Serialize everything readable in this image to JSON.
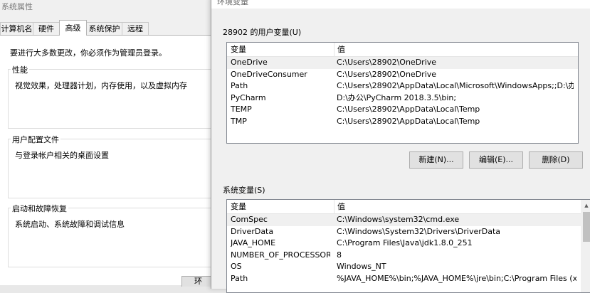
{
  "system_properties": {
    "title": "系统属性",
    "tabs": [
      "计算机名",
      "硬件",
      "高级",
      "系统保护",
      "远程"
    ],
    "active_tab": "高级",
    "admin_note": "要进行大多数更改，你必须作为管理员登录。",
    "groups": [
      {
        "title": "性能",
        "desc": "视觉效果，处理器计划，内存使用，以及虚拟内存"
      },
      {
        "title": "用户配置文件",
        "desc": "与登录帐户相关的桌面设置"
      },
      {
        "title": "启动和故障恢复",
        "desc": "系统启动、系统故障和调试信息"
      }
    ],
    "bottom_button_label": "环"
  },
  "env_vars": {
    "title": "环境变量",
    "user_section": {
      "label": "28902 的用户变量(U)",
      "headers": {
        "name": "变量",
        "value": "值"
      },
      "rows": [
        {
          "name": "OneDrive",
          "value": "C:\\Users\\28902\\OneDrive"
        },
        {
          "name": "OneDriveConsumer",
          "value": "C:\\Users\\28902\\OneDrive"
        },
        {
          "name": "Path",
          "value": "C:\\Users\\28902\\AppData\\Local\\Microsoft\\WindowsApps;;D:\\办..."
        },
        {
          "name": "PyCharm",
          "value": "D:\\办公\\PyCharm 2018.3.5\\bin;"
        },
        {
          "name": "TEMP",
          "value": "C:\\Users\\28902\\AppData\\Local\\Temp"
        },
        {
          "name": "TMP",
          "value": "C:\\Users\\28902\\AppData\\Local\\Temp"
        }
      ],
      "buttons": {
        "new": "新建(N)...",
        "edit": "编辑(E)...",
        "delete": "删除(D)"
      }
    },
    "system_section": {
      "label": "系统变量(S)",
      "headers": {
        "name": "变量",
        "value": "值"
      },
      "rows": [
        {
          "name": "ComSpec",
          "value": "C:\\Windows\\system32\\cmd.exe"
        },
        {
          "name": "DriverData",
          "value": "C:\\Windows\\System32\\Drivers\\DriverData"
        },
        {
          "name": "JAVA_HOME",
          "value": "C:\\Program Files\\Java\\jdk1.8.0_251"
        },
        {
          "name": "NUMBER_OF_PROCESSORS",
          "value": "8"
        },
        {
          "name": "OS",
          "value": "Windows_NT"
        },
        {
          "name": "Path",
          "value": "%JAVA_HOME%\\bin;%JAVA_HOME%\\jre\\bin;C:\\Program Files (x..."
        }
      ]
    }
  },
  "colors": {
    "selected_row": "#f0f0f0",
    "button_bg": "#e1e1e1",
    "list_border": "#828790"
  }
}
